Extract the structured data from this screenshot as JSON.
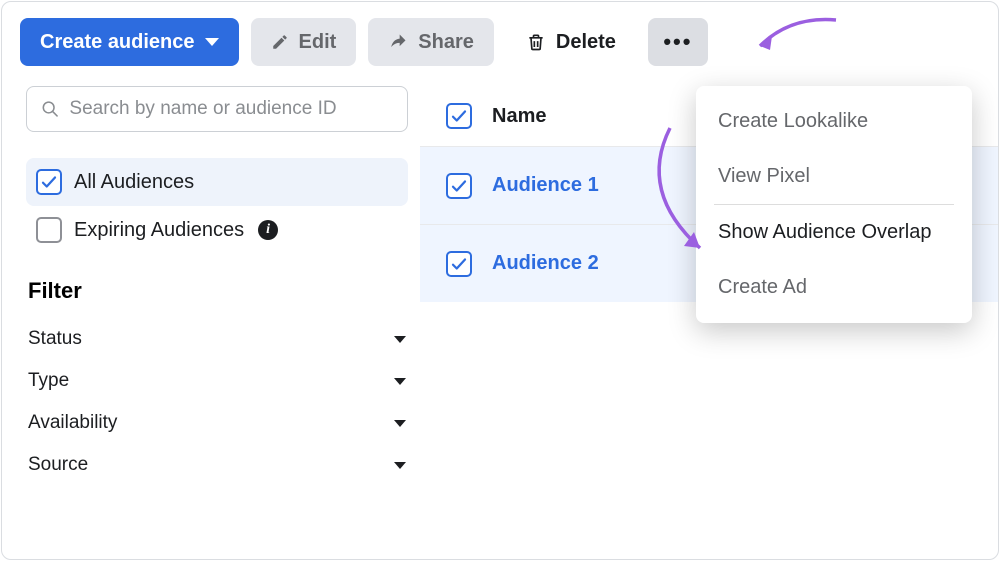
{
  "toolbar": {
    "create_label": "Create audience",
    "edit_label": "Edit",
    "share_label": "Share",
    "delete_label": "Delete",
    "more_label": "•••"
  },
  "search": {
    "placeholder": "Search by name or audience ID"
  },
  "sidebar": {
    "all_audiences": "All Audiences",
    "expiring_audiences": "Expiring Audiences",
    "filter_title": "Filter",
    "filters": {
      "status": "Status",
      "type": "Type",
      "availability": "Availability",
      "source": "Source"
    }
  },
  "table": {
    "header_name": "Name",
    "rows": [
      {
        "name": "Audience 1"
      },
      {
        "name": "Audience 2"
      }
    ]
  },
  "dropdown": {
    "create_lookalike": "Create Lookalike",
    "view_pixel": "View Pixel",
    "show_overlap": "Show Audience Overlap",
    "create_ad": "Create Ad"
  },
  "colors": {
    "primary": "#2d6cdf",
    "annotation": "#9b5fe0"
  }
}
